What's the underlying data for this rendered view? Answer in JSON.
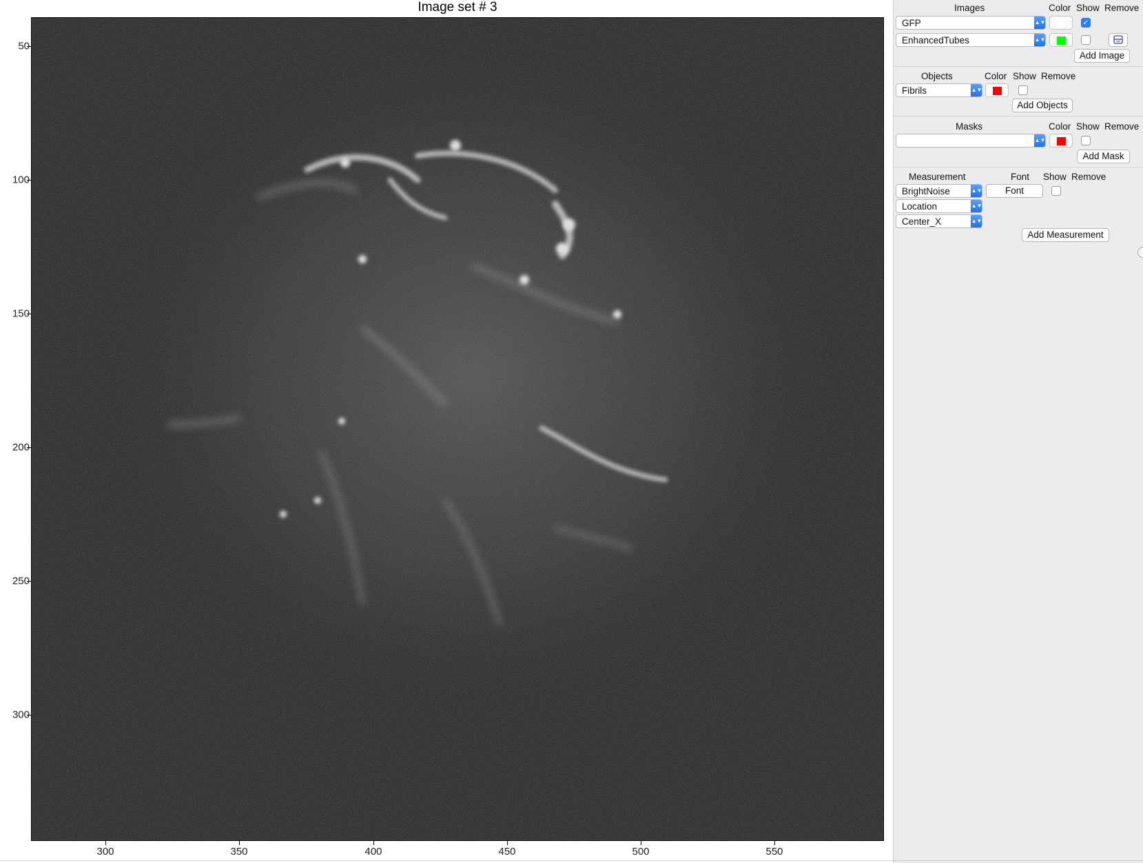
{
  "figure": {
    "title": "Image set # 3",
    "x_ticks": [
      "300",
      "350",
      "400",
      "450",
      "500",
      "550"
    ],
    "y_ticks": [
      "50",
      "100",
      "150",
      "200",
      "250",
      "300"
    ]
  },
  "panel": {
    "images": {
      "header": "Images",
      "color_header": "Color",
      "show_header": "Show",
      "remove_header": "Remove",
      "rows": [
        {
          "name": "GFP",
          "color": "#ffffff",
          "show": true
        },
        {
          "name": "EnhancedTubes",
          "color": "#00ff00",
          "show": false
        }
      ],
      "add_label": "Add Image"
    },
    "objects": {
      "header": "Objects",
      "color_header": "Color",
      "show_header": "Show",
      "remove_header": "Remove",
      "row": {
        "name": "Fibrils",
        "color": "#ff0000",
        "show": false
      },
      "add_label": "Add Objects"
    },
    "masks": {
      "header": "Masks",
      "color_header": "Color",
      "show_header": "Show",
      "remove_header": "Remove",
      "row": {
        "name": "",
        "color": "#ff0000",
        "show": false
      },
      "add_label": "Add Mask"
    },
    "measurements": {
      "header": "Measurement",
      "font_header": "Font",
      "show_header": "Show",
      "remove_header": "Remove",
      "category": "BrightNoise",
      "feature": "Location",
      "sub_feature": "Center_X",
      "font_label": "Font",
      "show": false,
      "add_label": "Add Measurement"
    }
  }
}
